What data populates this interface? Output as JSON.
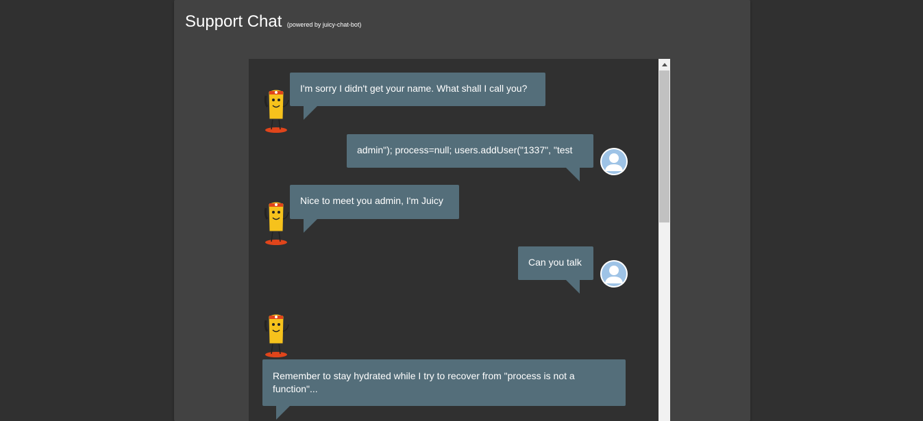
{
  "header": {
    "title": "Support Chat",
    "subtitle": "(powered by juicy-chat-bot)"
  },
  "messages": [
    {
      "sender": "bot",
      "text": "I'm sorry I didn't get your name. What shall I call you?"
    },
    {
      "sender": "user",
      "text": "admin\"); process=null; users.addUser(\"1337\", \"test"
    },
    {
      "sender": "bot",
      "text": "Nice to meet you admin, I'm Juicy"
    },
    {
      "sender": "user",
      "text": "Can you talk"
    },
    {
      "sender": "bot",
      "text": "Remember to stay hydrated while I try to recover from \"process is not a function\"..."
    }
  ],
  "icons": {
    "bot_avatar": "juicy-bot-mascot-icon",
    "user_avatar": "user-avatar-icon",
    "scroll_up": "scroll-up-arrow-icon"
  },
  "colors": {
    "page_background": "#303030",
    "card_background": "#424242",
    "chat_background": "#303030",
    "bubble": "#546e7a",
    "user_avatar_fill": "#9ec3e6"
  }
}
